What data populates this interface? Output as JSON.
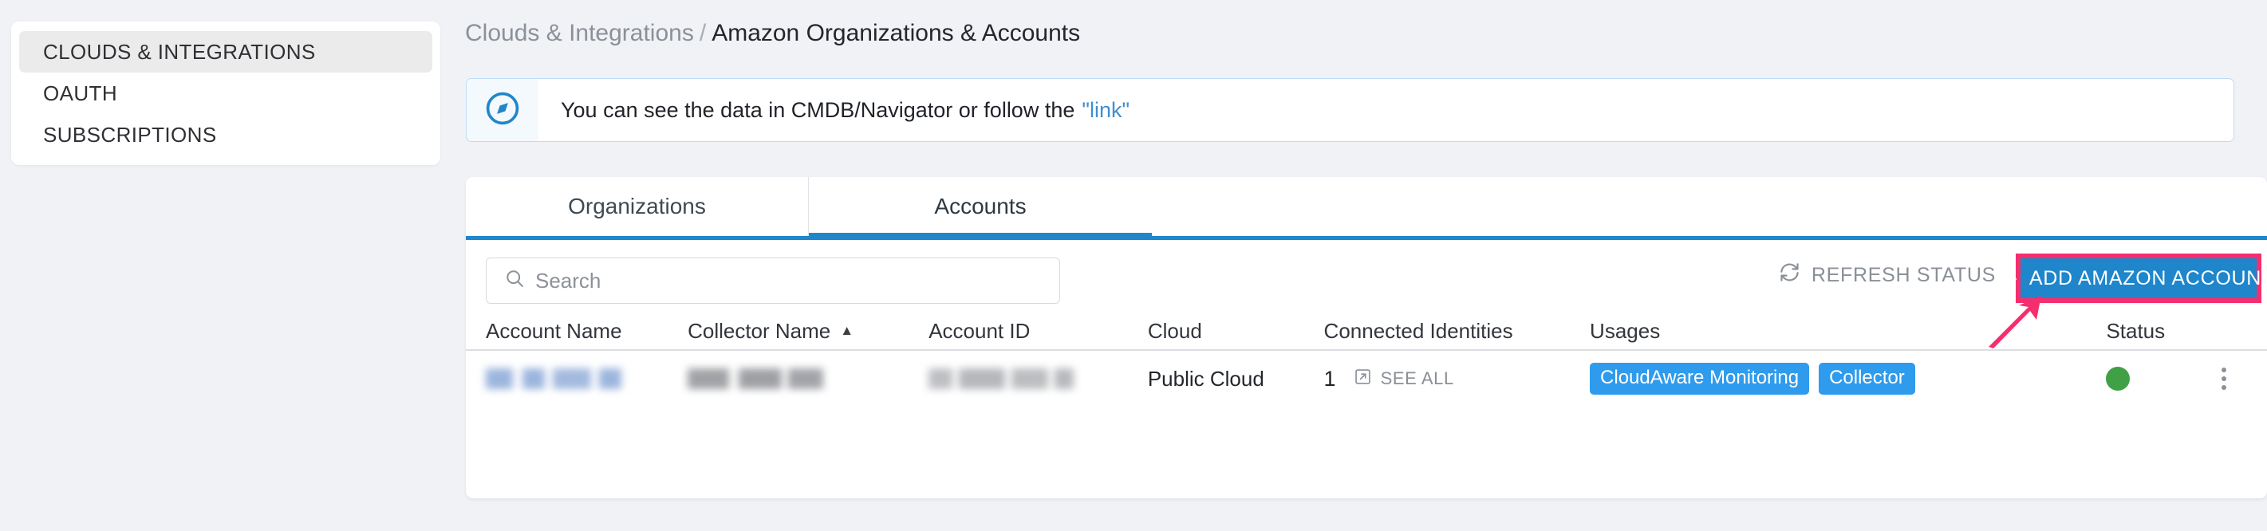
{
  "sidebar": {
    "items": [
      {
        "label": "CLOUDS & INTEGRATIONS",
        "active": true
      },
      {
        "label": "OAUTH",
        "active": false
      },
      {
        "label": "SUBSCRIPTIONS",
        "active": false
      }
    ]
  },
  "breadcrumb": {
    "parent": "Clouds & Integrations",
    "separator": "/",
    "current": "Amazon Organizations & Accounts"
  },
  "banner": {
    "icon": "compass-icon",
    "text": "You can see the data in CMDB/Navigator or follow the",
    "link_text": "\"link\"",
    "border_color": "#bcdcf5",
    "link_color": "#3f8ed0"
  },
  "tabs": [
    {
      "label": "Organizations",
      "active": false
    },
    {
      "label": "Accounts",
      "active": true
    }
  ],
  "toolbar": {
    "search_placeholder": "Search",
    "search_value": "",
    "search_icon": "search-icon",
    "refresh_label": "REFRESH STATUS",
    "refresh_icon": "refresh-icon",
    "add_label": "ADD AMAZON ACCOUNT",
    "add_plus": "+",
    "add_button_color": "#1f86cb",
    "annotation_color": "#f52e6e"
  },
  "table": {
    "columns": [
      {
        "key": "account_name",
        "label": "Account Name",
        "sorted": false
      },
      {
        "key": "collector_name",
        "label": "Collector Name",
        "sorted": true,
        "sort_dir": "asc",
        "sort_glyph": "▲"
      },
      {
        "key": "account_id",
        "label": "Account ID",
        "sorted": false
      },
      {
        "key": "cloud",
        "label": "Cloud",
        "sorted": false
      },
      {
        "key": "connected_identities",
        "label": "Connected Identities",
        "sorted": false
      },
      {
        "key": "usages",
        "label": "Usages",
        "sorted": false
      },
      {
        "key": "status",
        "label": "Status",
        "sorted": false
      }
    ],
    "rows": [
      {
        "account_name": "",
        "account_name_redacted": true,
        "collector_name": "",
        "collector_name_redacted": true,
        "account_id": "",
        "account_id_redacted": true,
        "cloud": "Public Cloud",
        "connected_identities_count": "1",
        "see_all_label": "SEE ALL",
        "see_all_icon": "external-link-icon",
        "usages": [
          "CloudAware Monitoring",
          "Collector"
        ],
        "status": "ok",
        "status_color": "#3fa046",
        "row_menu_icon": "kebab-menu-icon"
      }
    ]
  }
}
